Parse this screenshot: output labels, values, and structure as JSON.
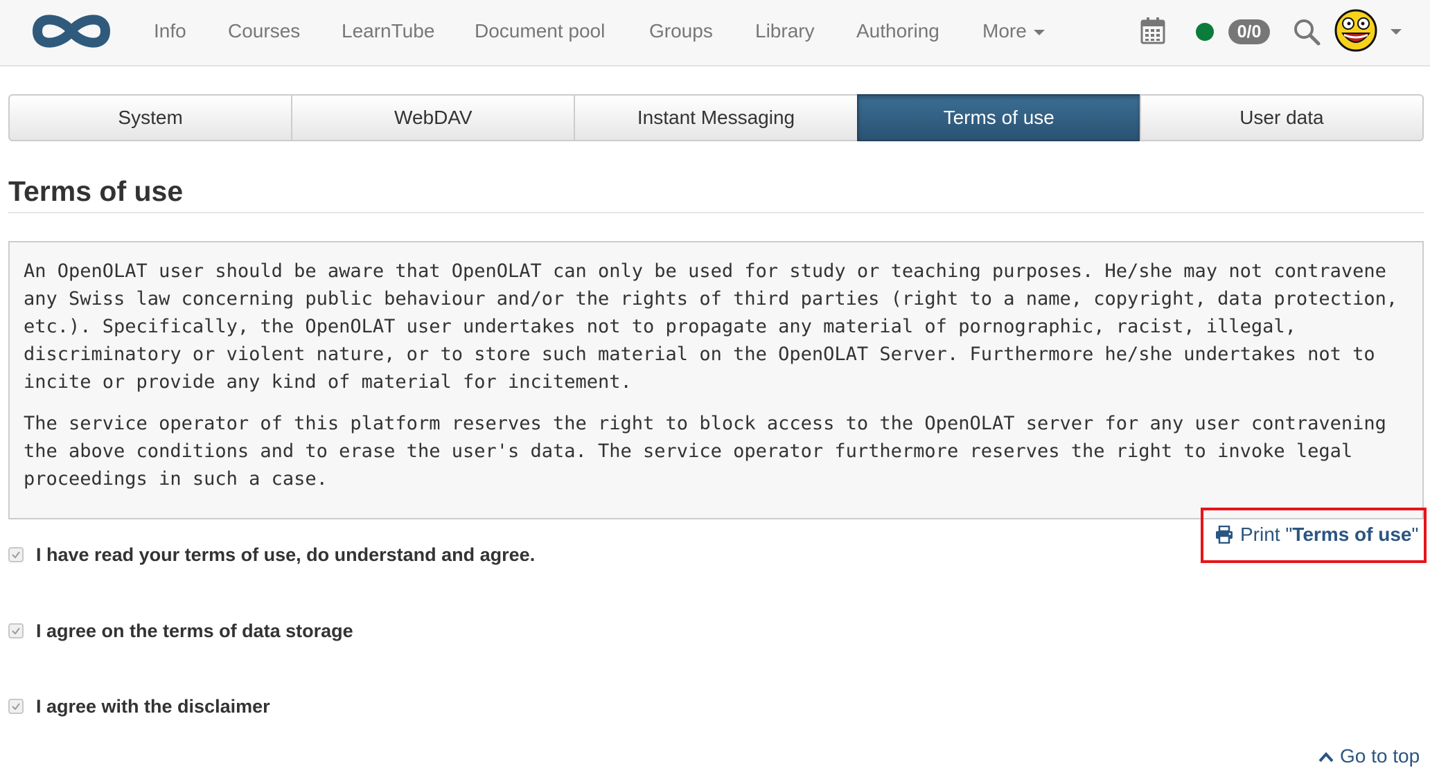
{
  "nav": {
    "items": [
      "Info",
      "Courses",
      "LearnTube",
      "Document pool",
      "Groups",
      "Library",
      "Authoring"
    ],
    "more_label": "More",
    "counter": "0/0"
  },
  "tabs": [
    "System",
    "WebDAV",
    "Instant Messaging",
    "Terms of use",
    "User data"
  ],
  "active_tab": "Terms of use",
  "page": {
    "title": "Terms of use"
  },
  "terms": {
    "paragraph1": "An OpenOLAT user should be aware that OpenOLAT can only be used for study or teaching purposes. He/she may not contravene any Swiss law concerning public behaviour and/or the rights of third parties (right to a name, copyright, data protection, etc.). Specifically, the OpenOLAT user undertakes not to propagate any material of pornographic, racist, illegal, discriminatory or violent nature, or to store such material on the OpenOLAT Server. Furthermore he/she undertakes not to incite or provide any kind of material for incitement.",
    "paragraph2": "The service operator of this platform reserves the right to block access to the OpenOLAT server for any user contravening the above conditions and to erase the user's data. The service operator furthermore reserves the right to invoke legal proceedings in such a case."
  },
  "print": {
    "prefix": "Print \"",
    "name": "Terms of use",
    "suffix": "\""
  },
  "checkboxes": [
    {
      "label": "I have read your terms of use, do understand and agree.",
      "checked": true
    },
    {
      "label": "I agree on the terms of data storage",
      "checked": true
    },
    {
      "label": "I agree with the disclaimer",
      "checked": true
    }
  ],
  "footer": {
    "go_to_top": "Go to top"
  },
  "icons": {
    "logo": "infinity-logo-icon",
    "calendar": "calendar-icon",
    "status": "online-status-icon",
    "search": "search-icon",
    "avatar": "avatar-icon",
    "print": "printer-icon",
    "go_to_top": "chevron-up-icon",
    "checkbox": "checkmark-icon"
  },
  "colors": {
    "brand": "#2b5273",
    "link": "#2b5580",
    "status_online": "#0a7c3b",
    "highlight": "#e8141a"
  }
}
